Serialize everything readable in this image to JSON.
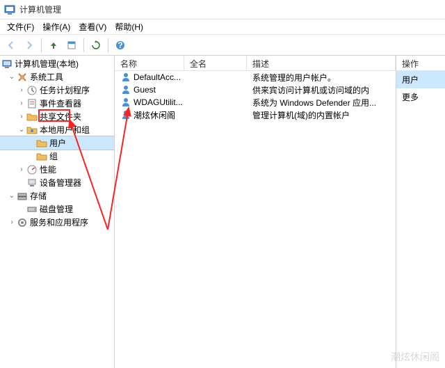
{
  "window": {
    "title": "计算机管理"
  },
  "menu": {
    "file": "文件(F)",
    "action": "操作(A)",
    "view": "查看(V)",
    "help": "帮助(H)"
  },
  "tree": {
    "root": "计算机管理(本地)",
    "sys_tools": "系统工具",
    "task_sched": "任务计划程序",
    "event_viewer": "事件查看器",
    "shared": "共享文件夹",
    "local_users": "本地用户和组",
    "users": "用户",
    "groups": "组",
    "perf": "性能",
    "devmgr": "设备管理器",
    "storage": "存储",
    "diskmgmt": "磁盘管理",
    "services": "服务和应用程序"
  },
  "list": {
    "cols": {
      "name": "名称",
      "fullname": "全名",
      "desc": "描述"
    },
    "rows": [
      {
        "name": "DefaultAcc...",
        "fullname": "",
        "desc": "系统管理的用户帐户。"
      },
      {
        "name": "Guest",
        "fullname": "",
        "desc": "供来宾访问计算机或访问域的内"
      },
      {
        "name": "WDAGUtilit...",
        "fullname": "",
        "desc": "系统为 Windows Defender 应用..."
      },
      {
        "name": "潮炫休闲阁",
        "fullname": "",
        "desc": "管理计算机(域)的内置帐户"
      }
    ]
  },
  "actions": {
    "header": "操作",
    "user": "用户",
    "more": "更多"
  },
  "watermark": "潮炫休闲阁"
}
